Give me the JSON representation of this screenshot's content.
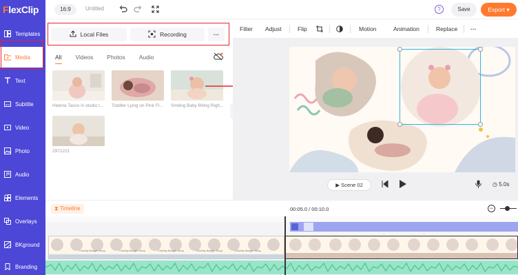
{
  "app": {
    "logo_prefix": "F",
    "logo_rest": "lexClip"
  },
  "sidebar": {
    "items": [
      {
        "label": "Templates",
        "icon": "templates-icon"
      },
      {
        "label": "Media",
        "icon": "media-folder-icon"
      },
      {
        "label": "Text",
        "icon": "text-icon"
      },
      {
        "label": "Subtitle",
        "icon": "subtitle-icon"
      },
      {
        "label": "Video",
        "icon": "video-icon"
      },
      {
        "label": "Photo",
        "icon": "photo-icon"
      },
      {
        "label": "Audio",
        "icon": "audio-icon"
      },
      {
        "label": "Elements",
        "icon": "elements-icon"
      },
      {
        "label": "Overlays",
        "icon": "overlays-icon"
      },
      {
        "label": "BKground",
        "icon": "background-icon"
      },
      {
        "label": "Branding",
        "icon": "branding-icon"
      }
    ],
    "active_index": 1
  },
  "header": {
    "ratio": "16:9",
    "title": "Untitled",
    "help": "?",
    "save": "Save",
    "export": "Export"
  },
  "media": {
    "local_files": "Local Files",
    "recording": "Recording",
    "more": "···",
    "tabs": [
      "All",
      "Videos",
      "Photos",
      "Audio"
    ],
    "items": [
      {
        "caption": "Helena Tasso in studio t..."
      },
      {
        "caption": "Toddler Lying on Pink Fl..."
      },
      {
        "caption": "Smiling Baby Biting Righ..."
      },
      {
        "caption": "2972221"
      }
    ]
  },
  "toolbar": {
    "filter": "Filter",
    "adjust": "Adjust",
    "flip": "Flip",
    "motion": "Motion",
    "animation": "Animation",
    "replace": "Replace",
    "more": "···"
  },
  "player": {
    "scene": "Scene 02",
    "time": "5.0s"
  },
  "timeline": {
    "label": "Timeline",
    "current": "00:05.0",
    "total": "00:10.0",
    "separator": " / ",
    "clip_text": "Chubby Beagle Shop"
  },
  "colors": {
    "brand": "#4c47d6",
    "accent": "#ff7a2f",
    "highlight": "#e8242a"
  }
}
